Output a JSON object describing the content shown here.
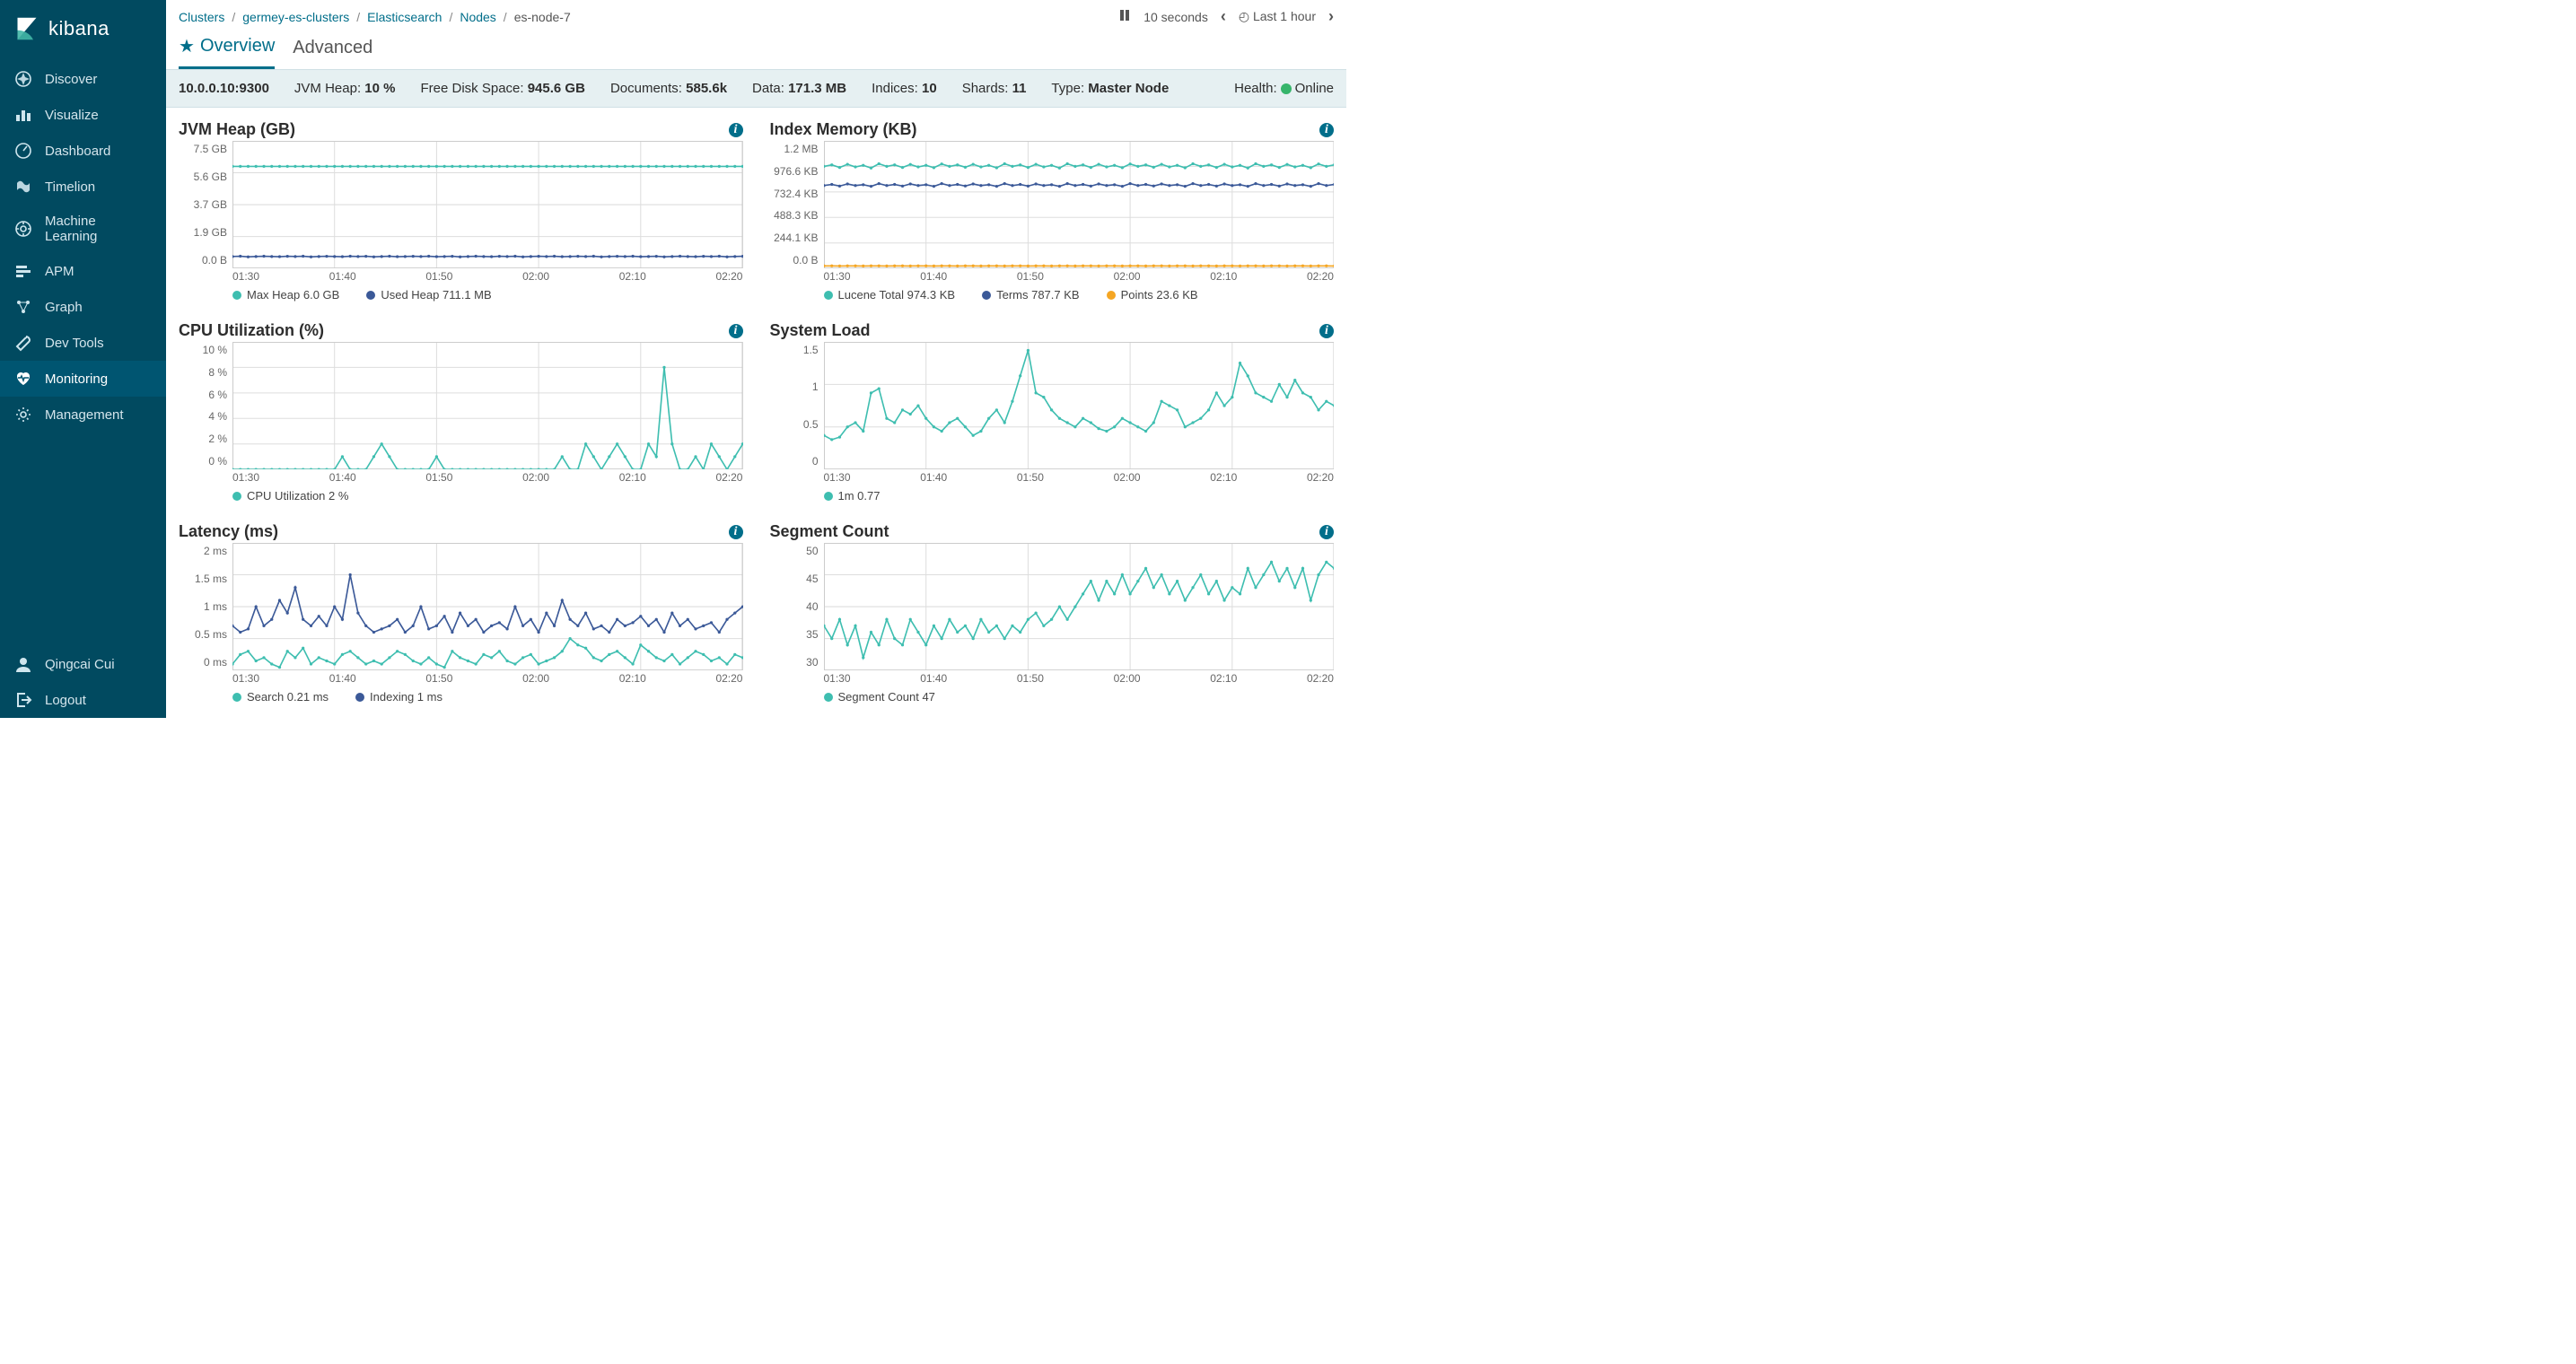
{
  "app": {
    "name": "kibana"
  },
  "sidebar": {
    "items": [
      {
        "label": "Discover",
        "id": "discover"
      },
      {
        "label": "Visualize",
        "id": "visualize"
      },
      {
        "label": "Dashboard",
        "id": "dashboard"
      },
      {
        "label": "Timelion",
        "id": "timelion"
      },
      {
        "label": "Machine Learning",
        "id": "ml"
      },
      {
        "label": "APM",
        "id": "apm"
      },
      {
        "label": "Graph",
        "id": "graph"
      },
      {
        "label": "Dev Tools",
        "id": "devtools"
      },
      {
        "label": "Monitoring",
        "id": "monitoring",
        "active": true
      },
      {
        "label": "Management",
        "id": "management"
      }
    ],
    "user": "Qingcai Cui",
    "logout": "Logout"
  },
  "breadcrumb": [
    "Clusters",
    "germey-es-clusters",
    "Elasticsearch",
    "Nodes",
    "es-node-7"
  ],
  "time": {
    "interval": "10 seconds",
    "range": "Last 1 hour"
  },
  "tabs": {
    "overview": "Overview",
    "advanced": "Advanced"
  },
  "stats": {
    "address": "10.0.0.10:9300",
    "jvm_heap_label": "JVM Heap:",
    "jvm_heap": "10 %",
    "disk_label": "Free Disk Space:",
    "disk": "945.6 GB",
    "docs_label": "Documents:",
    "docs": "585.6k",
    "data_label": "Data:",
    "data": "171.3 MB",
    "indices_label": "Indices:",
    "indices": "10",
    "shards_label": "Shards:",
    "shards": "11",
    "type_label": "Type:",
    "type": "Master Node",
    "health_label": "Health:",
    "health": "Online"
  },
  "chart_data": [
    {
      "id": "jvm-heap",
      "title": "JVM Heap (GB)",
      "type": "line",
      "x_ticks": [
        "01:30",
        "01:40",
        "01:50",
        "02:00",
        "02:10",
        "02:20"
      ],
      "y_ticks": [
        "0.0 B",
        "1.9 GB",
        "3.7 GB",
        "5.6 GB",
        "7.5 GB"
      ],
      "ylim": [
        0,
        7.5
      ],
      "series": [
        {
          "name": "Max Heap",
          "label": "Max Heap  6.0 GB",
          "color": "#3ebeb0",
          "values": [
            6,
            6,
            6,
            6,
            6,
            6,
            6,
            6,
            6,
            6,
            6,
            6,
            6,
            6,
            6,
            6,
            6,
            6,
            6,
            6,
            6,
            6,
            6,
            6,
            6,
            6,
            6,
            6,
            6,
            6,
            6,
            6,
            6,
            6,
            6,
            6,
            6,
            6,
            6,
            6,
            6,
            6,
            6,
            6,
            6,
            6,
            6,
            6,
            6,
            6,
            6,
            6,
            6,
            6,
            6,
            6,
            6,
            6,
            6,
            6,
            6,
            6,
            6,
            6,
            6,
            6
          ]
        },
        {
          "name": "Used Heap",
          "label": "Used Heap  711.1 MB",
          "color": "#3b5998",
          "values": [
            0.7,
            0.72,
            0.68,
            0.7,
            0.72,
            0.7,
            0.69,
            0.71,
            0.7,
            0.72,
            0.68,
            0.7,
            0.71,
            0.7,
            0.69,
            0.72,
            0.7,
            0.71,
            0.68,
            0.7,
            0.72,
            0.69,
            0.7,
            0.71,
            0.7,
            0.72,
            0.69,
            0.7,
            0.71,
            0.68,
            0.7,
            0.72,
            0.7,
            0.69,
            0.71,
            0.7,
            0.72,
            0.68,
            0.7,
            0.71,
            0.7,
            0.72,
            0.69,
            0.7,
            0.71,
            0.7,
            0.72,
            0.68,
            0.7,
            0.71,
            0.7,
            0.72,
            0.69,
            0.7,
            0.71,
            0.68,
            0.7,
            0.72,
            0.7,
            0.69,
            0.71,
            0.7,
            0.72,
            0.68,
            0.7,
            0.71
          ]
        }
      ]
    },
    {
      "id": "index-memory",
      "title": "Index Memory (KB)",
      "type": "line",
      "x_ticks": [
        "01:30",
        "01:40",
        "01:50",
        "02:00",
        "02:10",
        "02:20"
      ],
      "y_ticks": [
        "0.0 B",
        "244.1 KB",
        "488.3 KB",
        "732.4 KB",
        "976.6 KB",
        "1.2 MB"
      ],
      "ylim": [
        0,
        1200
      ],
      "series": [
        {
          "name": "Lucene Total",
          "label": "Lucene Total  974.3 KB",
          "color": "#3ebeb0",
          "values": [
            960,
            975,
            950,
            980,
            955,
            970,
            945,
            985,
            960,
            975,
            950,
            978,
            955,
            970,
            948,
            982,
            960,
            975,
            952,
            980,
            955,
            970,
            946,
            985,
            960,
            975,
            950,
            980,
            955,
            970,
            945,
            985,
            960,
            975,
            950,
            980,
            955,
            970,
            948,
            982,
            960,
            975,
            952,
            980,
            955,
            970,
            946,
            985,
            960,
            975,
            950,
            980,
            955,
            970,
            945,
            985,
            960,
            975,
            950,
            978,
            955,
            970,
            948,
            982,
            960,
            975
          ]
        },
        {
          "name": "Terms",
          "label": "Terms  787.7 KB",
          "color": "#3b5998",
          "values": [
            780,
            790,
            775,
            795,
            780,
            788,
            772,
            798,
            780,
            790,
            775,
            795,
            780,
            788,
            772,
            798,
            780,
            790,
            776,
            795,
            780,
            788,
            772,
            798,
            780,
            790,
            775,
            795,
            780,
            788,
            772,
            798,
            780,
            790,
            775,
            795,
            780,
            788,
            772,
            798,
            780,
            790,
            776,
            795,
            780,
            788,
            772,
            798,
            780,
            790,
            775,
            795,
            780,
            788,
            772,
            798,
            780,
            790,
            775,
            795,
            780,
            788,
            772,
            798,
            780,
            790
          ]
        },
        {
          "name": "Points",
          "label": "Points  23.6 KB",
          "color": "#f5a623",
          "values": [
            24,
            24,
            23,
            24,
            24,
            23,
            24,
            24,
            23,
            24,
            24,
            23,
            24,
            24,
            23,
            24,
            24,
            23,
            24,
            24,
            23,
            24,
            24,
            23,
            24,
            24,
            23,
            24,
            24,
            23,
            24,
            24,
            23,
            24,
            24,
            23,
            24,
            24,
            23,
            24,
            24,
            23,
            24,
            24,
            23,
            24,
            24,
            23,
            24,
            24,
            23,
            24,
            24,
            23,
            24,
            24,
            23,
            24,
            24,
            23,
            24,
            24,
            23,
            24,
            24,
            23
          ]
        }
      ]
    },
    {
      "id": "cpu",
      "title": "CPU Utilization (%)",
      "type": "line",
      "x_ticks": [
        "01:30",
        "01:40",
        "01:50",
        "02:00",
        "02:10",
        "02:20"
      ],
      "y_ticks": [
        "0 %",
        "2 %",
        "4 %",
        "6 %",
        "8 %",
        "10 %"
      ],
      "ylim": [
        0,
        10
      ],
      "series": [
        {
          "name": "CPU Utilization",
          "label": "CPU Utilization  2 %",
          "color": "#3ebeb0",
          "values": [
            0,
            0,
            0,
            0,
            0,
            0,
            0,
            0,
            0,
            0,
            0,
            0,
            0,
            0,
            1,
            0,
            0,
            0,
            1,
            2,
            1,
            0,
            0,
            0,
            0,
            0,
            1,
            0,
            0,
            0,
            0,
            0,
            0,
            0,
            0,
            0,
            0,
            0,
            0,
            0,
            0,
            0,
            1,
            0,
            0,
            2,
            1,
            0,
            1,
            2,
            1,
            0,
            0,
            2,
            1,
            8,
            2,
            0,
            0,
            1,
            0,
            2,
            1,
            0,
            1,
            2
          ]
        }
      ]
    },
    {
      "id": "system-load",
      "title": "System Load",
      "type": "line",
      "x_ticks": [
        "01:30",
        "01:40",
        "01:50",
        "02:00",
        "02:10",
        "02:20"
      ],
      "y_ticks": [
        "0",
        "0.5",
        "1",
        "1.5"
      ],
      "ylim": [
        0,
        1.5
      ],
      "series": [
        {
          "name": "1m",
          "label": "1m  0.77",
          "color": "#3ebeb0",
          "values": [
            0.4,
            0.35,
            0.38,
            0.5,
            0.55,
            0.45,
            0.9,
            0.95,
            0.6,
            0.55,
            0.7,
            0.65,
            0.75,
            0.6,
            0.5,
            0.45,
            0.55,
            0.6,
            0.5,
            0.4,
            0.45,
            0.6,
            0.7,
            0.55,
            0.8,
            1.1,
            1.4,
            0.9,
            0.85,
            0.7,
            0.6,
            0.55,
            0.5,
            0.6,
            0.55,
            0.48,
            0.45,
            0.5,
            0.6,
            0.55,
            0.5,
            0.45,
            0.55,
            0.8,
            0.75,
            0.7,
            0.5,
            0.55,
            0.6,
            0.7,
            0.9,
            0.75,
            0.85,
            1.25,
            1.1,
            0.9,
            0.85,
            0.8,
            1.0,
            0.85,
            1.05,
            0.9,
            0.85,
            0.7,
            0.8,
            0.75
          ]
        }
      ]
    },
    {
      "id": "latency",
      "title": "Latency (ms)",
      "type": "line",
      "x_ticks": [
        "01:30",
        "01:40",
        "01:50",
        "02:00",
        "02:10",
        "02:20"
      ],
      "y_ticks": [
        "0 ms",
        "0.5 ms",
        "1 ms",
        "1.5 ms",
        "2 ms"
      ],
      "ylim": [
        0,
        2
      ],
      "series": [
        {
          "name": "Search",
          "label": "Search  0.21 ms",
          "color": "#3ebeb0",
          "values": [
            0.1,
            0.25,
            0.3,
            0.15,
            0.2,
            0.1,
            0.05,
            0.3,
            0.2,
            0.35,
            0.1,
            0.2,
            0.15,
            0.1,
            0.25,
            0.3,
            0.2,
            0.1,
            0.15,
            0.1,
            0.2,
            0.3,
            0.25,
            0.15,
            0.1,
            0.2,
            0.1,
            0.05,
            0.3,
            0.2,
            0.15,
            0.1,
            0.25,
            0.2,
            0.3,
            0.15,
            0.1,
            0.2,
            0.25,
            0.1,
            0.15,
            0.2,
            0.3,
            0.5,
            0.4,
            0.35,
            0.2,
            0.15,
            0.25,
            0.3,
            0.2,
            0.1,
            0.4,
            0.3,
            0.2,
            0.15,
            0.25,
            0.1,
            0.2,
            0.3,
            0.25,
            0.15,
            0.2,
            0.1,
            0.25,
            0.2
          ]
        },
        {
          "name": "Indexing",
          "label": "Indexing  1 ms",
          "color": "#3b5998",
          "values": [
            0.7,
            0.6,
            0.65,
            1.0,
            0.7,
            0.8,
            1.1,
            0.9,
            1.3,
            0.8,
            0.7,
            0.85,
            0.7,
            1.0,
            0.8,
            1.5,
            0.9,
            0.7,
            0.6,
            0.65,
            0.7,
            0.8,
            0.6,
            0.7,
            1.0,
            0.65,
            0.7,
            0.85,
            0.6,
            0.9,
            0.7,
            0.8,
            0.6,
            0.7,
            0.75,
            0.65,
            1.0,
            0.7,
            0.8,
            0.6,
            0.9,
            0.7,
            1.1,
            0.8,
            0.7,
            0.9,
            0.65,
            0.7,
            0.6,
            0.8,
            0.7,
            0.75,
            0.85,
            0.7,
            0.8,
            0.6,
            0.9,
            0.7,
            0.8,
            0.65,
            0.7,
            0.75,
            0.6,
            0.8,
            0.9,
            1.0
          ]
        }
      ]
    },
    {
      "id": "segment",
      "title": "Segment Count",
      "type": "line",
      "x_ticks": [
        "01:30",
        "01:40",
        "01:50",
        "02:00",
        "02:10",
        "02:20"
      ],
      "y_ticks": [
        "30",
        "35",
        "40",
        "45",
        "50"
      ],
      "ylim": [
        30,
        50
      ],
      "series": [
        {
          "name": "Segment Count",
          "label": "Segment Count  47",
          "color": "#3ebeb0",
          "values": [
            37,
            35,
            38,
            34,
            37,
            32,
            36,
            34,
            38,
            35,
            34,
            38,
            36,
            34,
            37,
            35,
            38,
            36,
            37,
            35,
            38,
            36,
            37,
            35,
            37,
            36,
            38,
            39,
            37,
            38,
            40,
            38,
            40,
            42,
            44,
            41,
            44,
            42,
            45,
            42,
            44,
            46,
            43,
            45,
            42,
            44,
            41,
            43,
            45,
            42,
            44,
            41,
            43,
            42,
            46,
            43,
            45,
            47,
            44,
            46,
            43,
            46,
            41,
            45,
            47,
            46
          ]
        }
      ]
    }
  ]
}
